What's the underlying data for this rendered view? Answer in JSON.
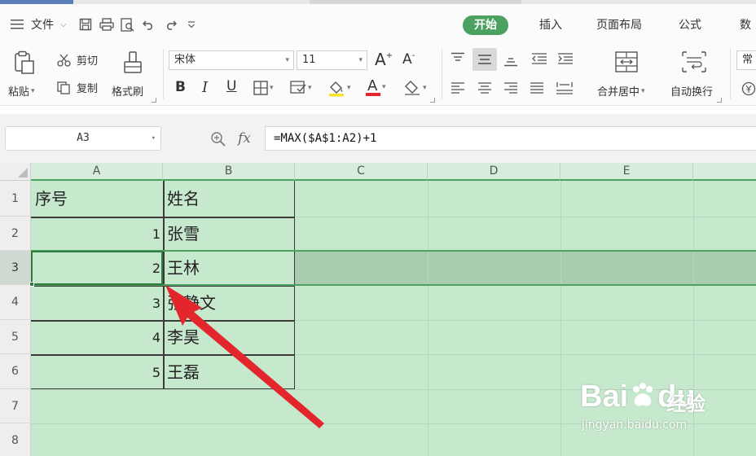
{
  "menubar": {
    "file_label": "文件",
    "tabs": [
      "开始",
      "插入",
      "页面布局",
      "公式",
      "数"
    ]
  },
  "ribbon": {
    "paste_label": "粘贴",
    "cut_label": "剪切",
    "copy_label": "复制",
    "format_painter_label": "格式刷",
    "font_name": "宋体",
    "font_size": "11",
    "grow_font": "A",
    "shrink_font": "A",
    "bold": "B",
    "italic": "I",
    "underline": "U",
    "font_color_letter": "A",
    "merge_center_label": "合并居中",
    "wrap_text_label": "自动换行",
    "number_format_partial": "常"
  },
  "formula_bar": {
    "name_box": "A3",
    "fx": "fx",
    "formula": "=MAX($A$1:A2)+1"
  },
  "grid": {
    "columns": [
      "A",
      "B",
      "C",
      "D",
      "E"
    ],
    "rows": [
      "1",
      "2",
      "3",
      "4",
      "5",
      "6",
      "7",
      "8"
    ],
    "selected_cell": "A3",
    "table": [
      {
        "a": "序号",
        "b": "姓名"
      },
      {
        "a": "1",
        "b": "张雪"
      },
      {
        "a": "2",
        "b": "王林"
      },
      {
        "a": "3",
        "b": "张静文"
      },
      {
        "a": "4",
        "b": "李昊"
      },
      {
        "a": "5",
        "b": "王磊"
      }
    ]
  },
  "watermark": {
    "brand": "Bai",
    "brand_tail": "du",
    "cn": "经验",
    "url": "jingyan.baidu.com"
  },
  "colors": {
    "accent_green": "#4aa160",
    "sheet_fill": "#c6e8cc",
    "selected_row_band": "#a9ccb0",
    "arrow_red": "#e3262b"
  }
}
